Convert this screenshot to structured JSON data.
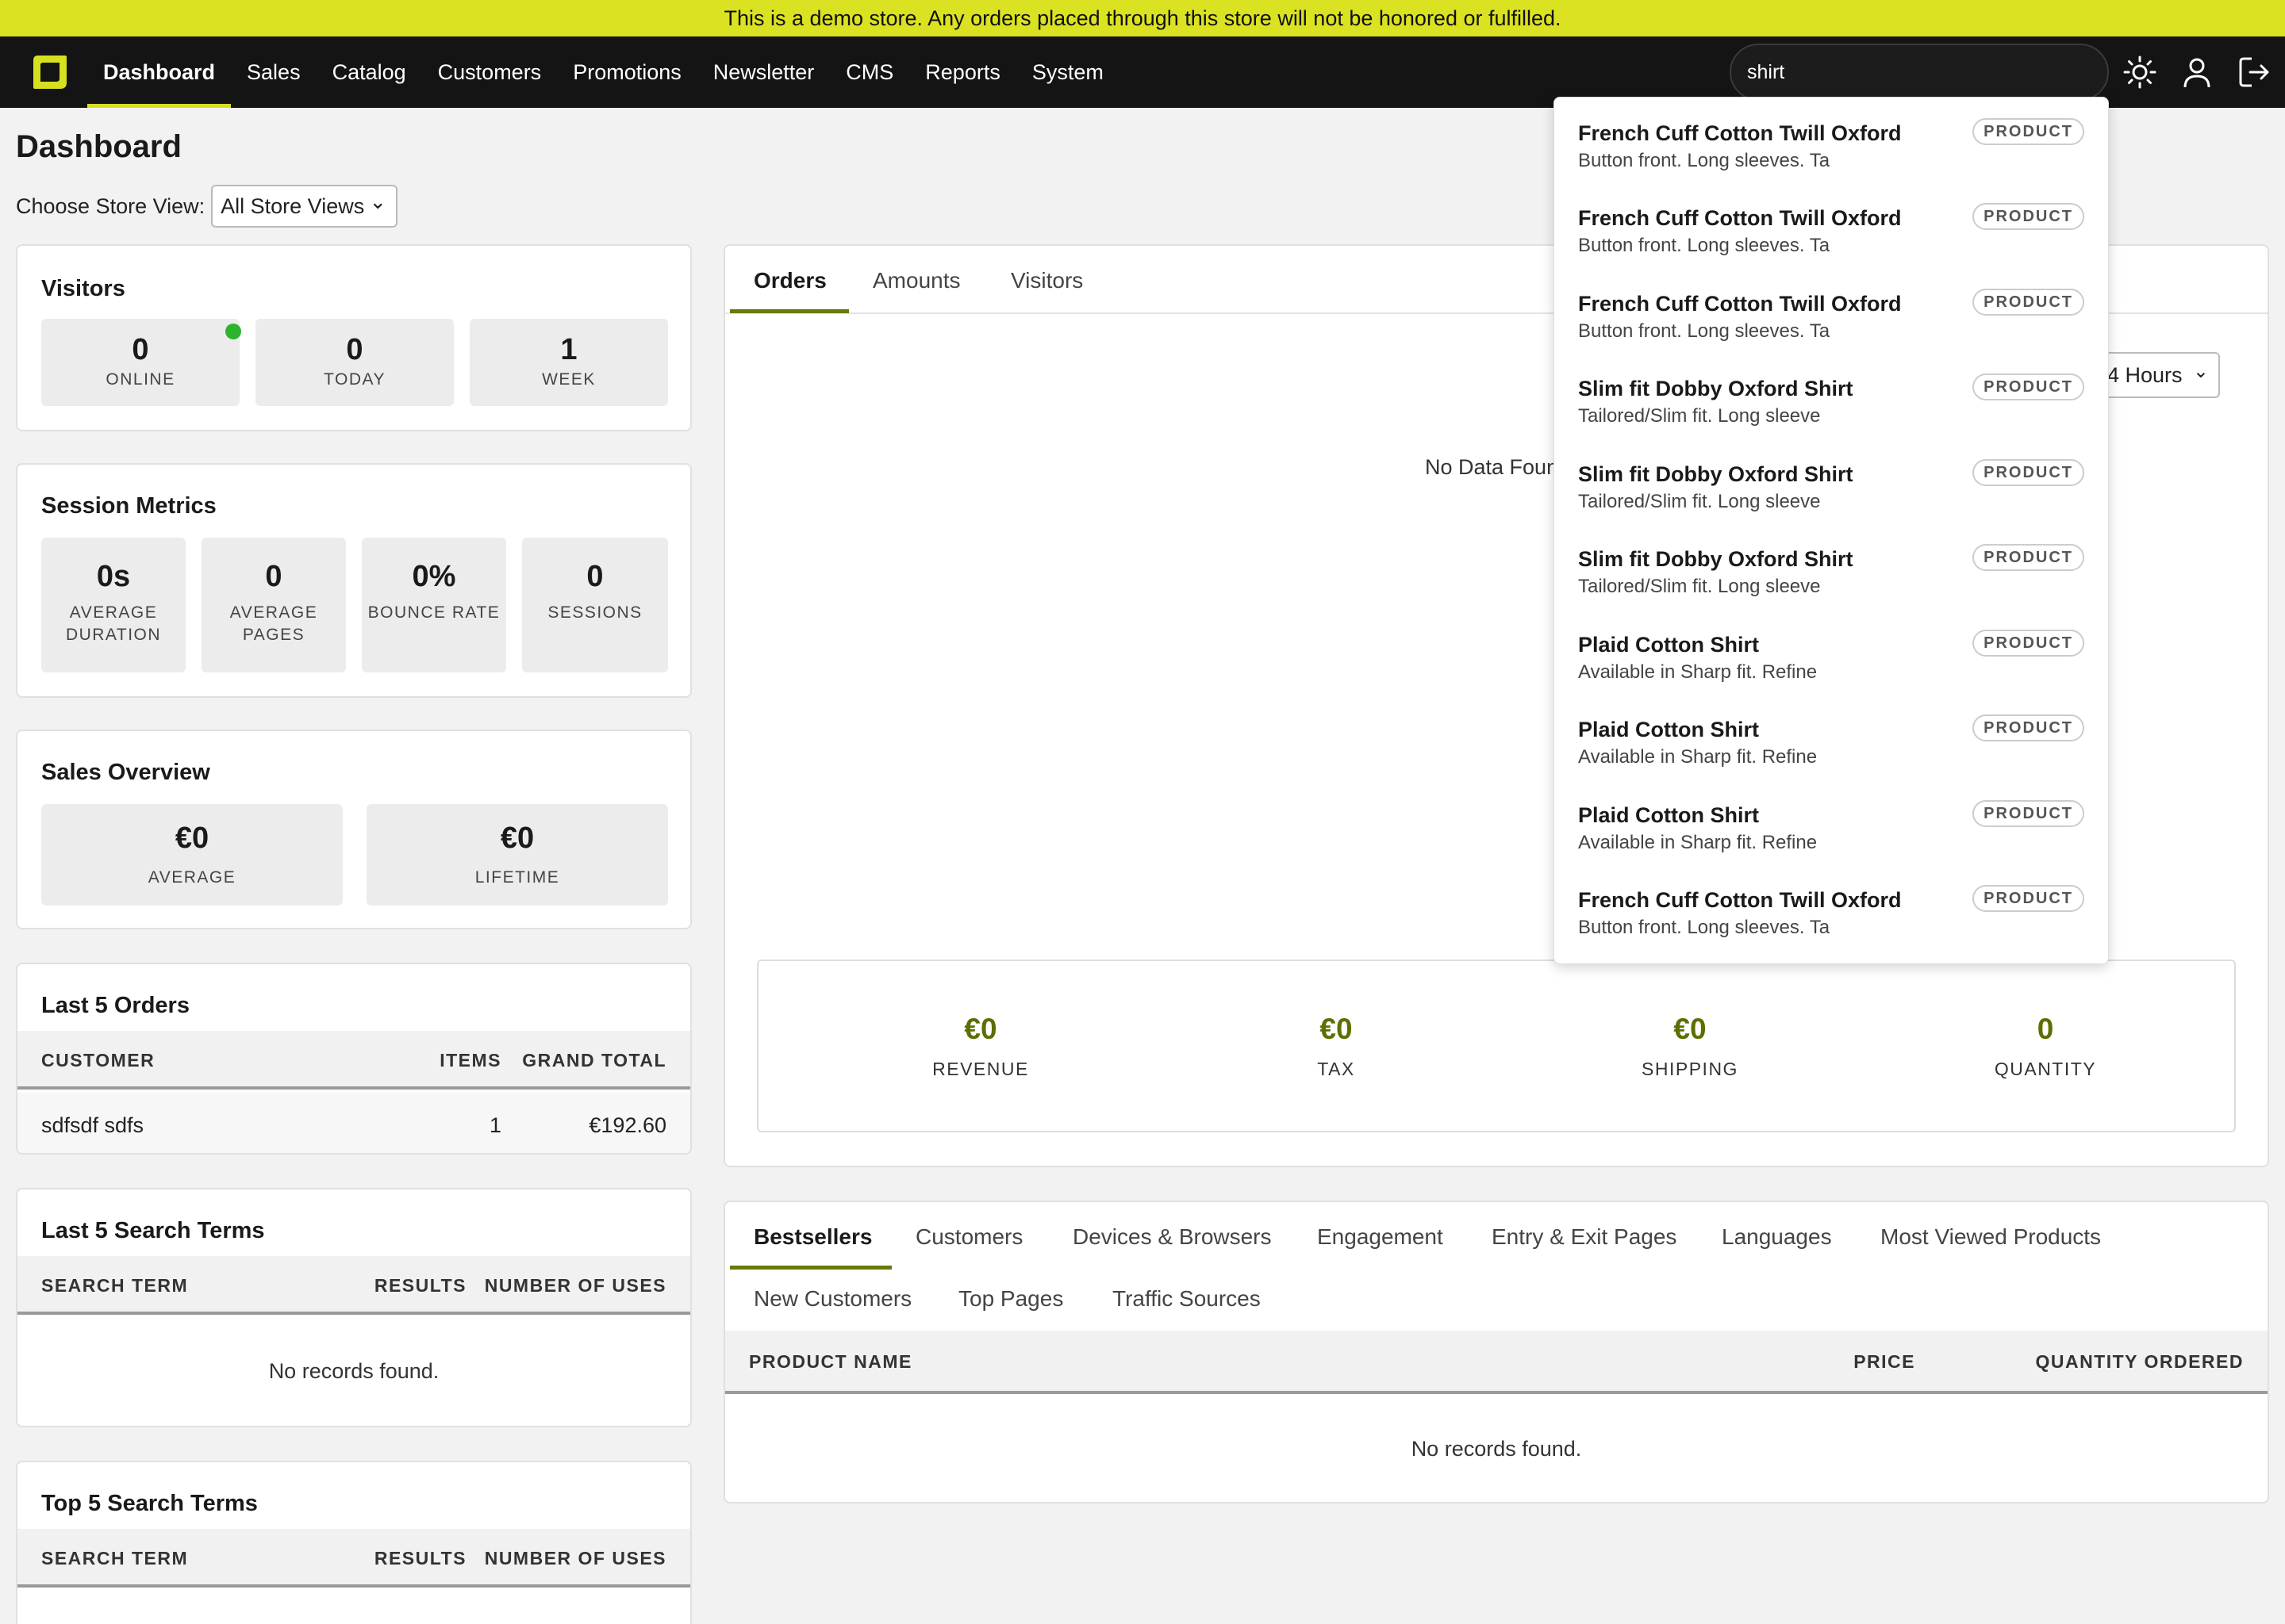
{
  "demo_banner": "This is a demo store. Any orders placed through this store will not be honored or fulfilled.",
  "nav": {
    "items": [
      {
        "label": "Dashboard"
      },
      {
        "label": "Sales"
      },
      {
        "label": "Catalog"
      },
      {
        "label": "Customers"
      },
      {
        "label": "Promotions"
      },
      {
        "label": "Newsletter"
      },
      {
        "label": "CMS"
      },
      {
        "label": "Reports"
      },
      {
        "label": "System"
      }
    ],
    "search_value": "shirt",
    "icons": [
      "logo-icon",
      "theme-toggle-icon",
      "user-icon",
      "logout-icon"
    ]
  },
  "page": {
    "title": "Dashboard",
    "store_view_label": "Choose Store View:",
    "store_view_value": "All Store Views"
  },
  "visitors": {
    "title": "Visitors",
    "stats": [
      {
        "value": "0",
        "label": "ONLINE"
      },
      {
        "value": "0",
        "label": "TODAY"
      },
      {
        "value": "1",
        "label": "WEEK"
      }
    ]
  },
  "session_metrics": {
    "title": "Session Metrics",
    "stats": [
      {
        "value": "0s",
        "label": "AVERAGE DURATION"
      },
      {
        "value": "0",
        "label": "AVERAGE PAGES"
      },
      {
        "value": "0%",
        "label": "BOUNCE RATE"
      },
      {
        "value": "0",
        "label": "SESSIONS"
      }
    ]
  },
  "sales_overview": {
    "title": "Sales Overview",
    "stats": [
      {
        "value": "€0",
        "label": "AVERAGE"
      },
      {
        "value": "€0",
        "label": "LIFETIME"
      }
    ]
  },
  "last_orders": {
    "title": "Last 5 Orders",
    "headers": [
      "CUSTOMER",
      "ITEMS",
      "GRAND TOTAL"
    ],
    "rows": [
      {
        "customer": "sdfsdf sdfs",
        "items": "1",
        "total": "€192.60"
      }
    ]
  },
  "last_search_terms": {
    "title": "Last 5 Search Terms",
    "headers": [
      "SEARCH TERM",
      "RESULTS",
      "NUMBER OF USES"
    ],
    "empty": "No records found."
  },
  "top_search_terms": {
    "title": "Top 5 Search Terms",
    "headers": [
      "SEARCH TERM",
      "RESULTS",
      "NUMBER OF USES"
    ]
  },
  "chart_panel": {
    "tabs": [
      "Orders",
      "Amounts",
      "Visitors"
    ],
    "period_partial": "4 Hours",
    "no_data": "No Data Foun",
    "summary": [
      {
        "value": "€0",
        "label": "REVENUE"
      },
      {
        "value": "€0",
        "label": "TAX"
      },
      {
        "value": "€0",
        "label": "SHIPPING"
      },
      {
        "value": "0",
        "label": "QUANTITY"
      }
    ]
  },
  "reports_panel": {
    "tabs_row1": [
      "Bestsellers",
      "Customers",
      "Devices & Browsers",
      "Engagement",
      "Entry & Exit Pages",
      "Languages",
      "Most Viewed Products"
    ],
    "tabs_row2": [
      "New Customers",
      "Top Pages",
      "Traffic Sources"
    ],
    "headers": [
      "PRODUCT NAME",
      "PRICE",
      "QUANTITY ORDERED"
    ],
    "empty": "No records found."
  },
  "search_results": [
    {
      "title": "French Cuff Cotton Twill Oxford",
      "desc": "Button front. Long sleeves. Ta",
      "badge": "PRODUCT"
    },
    {
      "title": "French Cuff Cotton Twill Oxford",
      "desc": "Button front. Long sleeves. Ta",
      "badge": "PRODUCT"
    },
    {
      "title": "French Cuff Cotton Twill Oxford",
      "desc": "Button front. Long sleeves. Ta",
      "badge": "PRODUCT"
    },
    {
      "title": "Slim fit Dobby Oxford Shirt",
      "desc": "Tailored/Slim fit. Long sleeve",
      "badge": "PRODUCT"
    },
    {
      "title": "Slim fit Dobby Oxford Shirt",
      "desc": "Tailored/Slim fit. Long sleeve",
      "badge": "PRODUCT"
    },
    {
      "title": "Slim fit Dobby Oxford Shirt",
      "desc": "Tailored/Slim fit. Long sleeve",
      "badge": "PRODUCT"
    },
    {
      "title": "Plaid Cotton Shirt",
      "desc": "Available in Sharp fit. Refine",
      "badge": "PRODUCT"
    },
    {
      "title": "Plaid Cotton Shirt",
      "desc": "Available in Sharp fit. Refine",
      "badge": "PRODUCT"
    },
    {
      "title": "Plaid Cotton Shirt",
      "desc": "Available in Sharp fit. Refine",
      "badge": "PRODUCT"
    },
    {
      "title": "French Cuff Cotton Twill Oxford",
      "desc": "Button front. Long sleeves. Ta",
      "badge": "PRODUCT"
    }
  ],
  "colors": {
    "demo_banner": "#dbe221",
    "nav_bg": "#141414",
    "accent": "#d6e01f",
    "summary_value": "#5a7000",
    "online_dot": "#2db32d"
  }
}
